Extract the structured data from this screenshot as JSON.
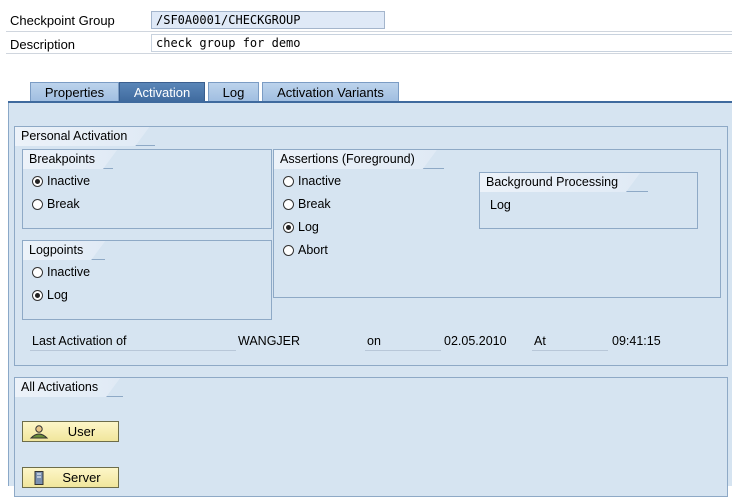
{
  "header": {
    "checkpoint_label": "Checkpoint Group",
    "checkpoint_value": "/SF0A0001/CHECKGROUP",
    "description_label": "Description",
    "description_value": "check group for demo"
  },
  "tabs": [
    {
      "label": "Properties",
      "active": false
    },
    {
      "label": "Activation",
      "active": true
    },
    {
      "label": "Log",
      "active": false
    },
    {
      "label": "Activation Variants",
      "active": false
    }
  ],
  "personal_activation": {
    "title": "Personal Activation",
    "breakpoints": {
      "title": "Breakpoints",
      "options": [
        {
          "label": "Inactive",
          "selected": true
        },
        {
          "label": "Break",
          "selected": false
        }
      ]
    },
    "logpoints": {
      "title": "Logpoints",
      "options": [
        {
          "label": "Inactive",
          "selected": false
        },
        {
          "label": "Log",
          "selected": true
        }
      ]
    },
    "assertions": {
      "title": "Assertions (Foreground)",
      "options": [
        {
          "label": "Inactive",
          "selected": false
        },
        {
          "label": "Break",
          "selected": false
        },
        {
          "label": "Log",
          "selected": true
        },
        {
          "label": "Abort",
          "selected": false
        }
      ]
    },
    "background": {
      "title": "Background Processing",
      "value": "Log"
    },
    "last_activation": {
      "label": "Last Activation of",
      "user": "WANGJER",
      "on_label": "on",
      "date": "02.05.2010",
      "at_label": "At",
      "time": "09:41:15"
    }
  },
  "all_activations": {
    "title": "All Activations",
    "user_button": "User",
    "server_button": "Server"
  },
  "colors": {
    "panel_bg": "#d6e4f1",
    "active_tab": "#3f6a9e",
    "button_bg": "#f1e69c"
  }
}
